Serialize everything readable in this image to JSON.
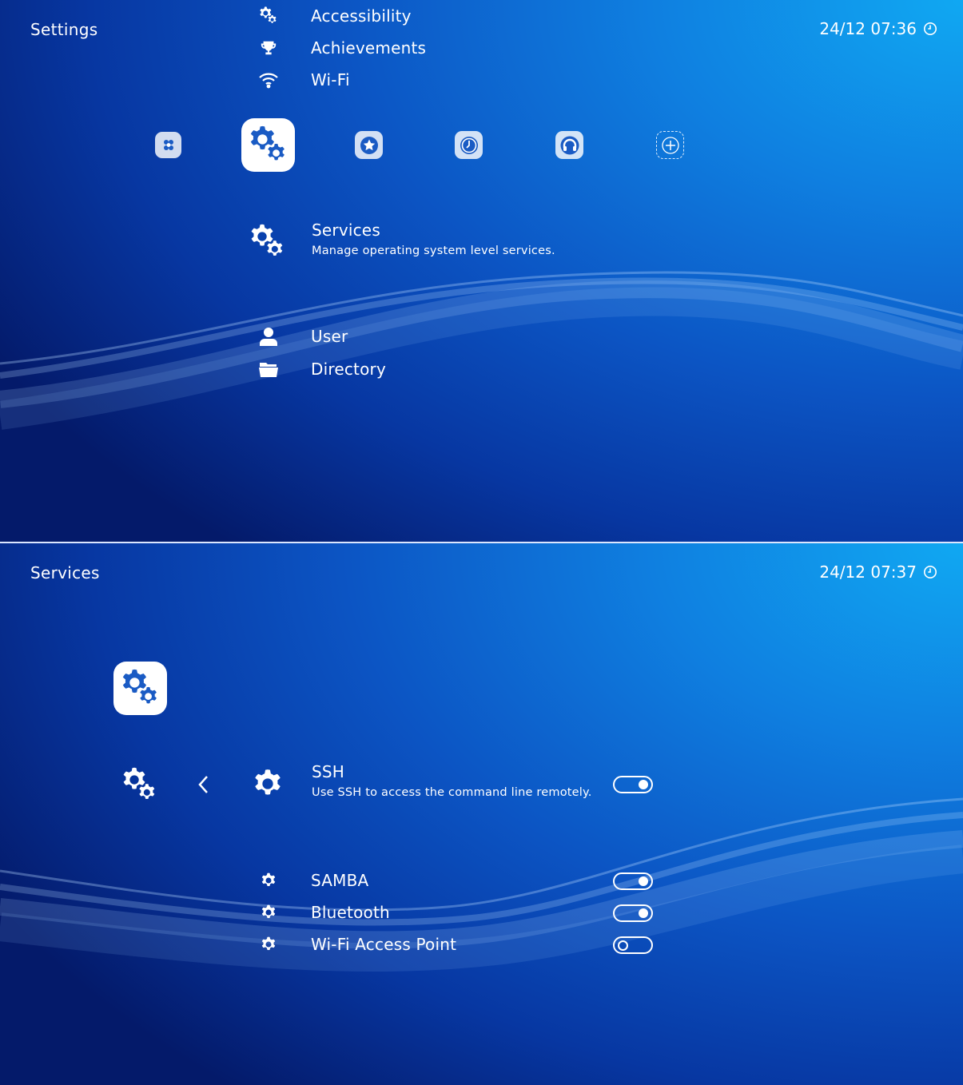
{
  "top": {
    "header": {
      "title": "Settings",
      "clock": "24/12 07:36"
    },
    "upper_items": [
      {
        "label": "Accessibility",
        "icon": "settings-gears-icon"
      },
      {
        "label": "Achievements",
        "icon": "trophy-icon"
      },
      {
        "label": "Wi-Fi",
        "icon": "wifi-icon"
      }
    ],
    "tabs": [
      {
        "icon": "main-menu-icon"
      },
      {
        "icon": "settings-gears-icon",
        "selected": true
      },
      {
        "icon": "favorites-star-icon"
      },
      {
        "icon": "history-clock-icon"
      },
      {
        "icon": "netplay-headset-icon"
      },
      {
        "icon": "add-plus-icon"
      }
    ],
    "selected_item": {
      "label": "Services",
      "description": "Manage operating system level services.",
      "icon": "settings-gears-icon"
    },
    "lower_items": [
      {
        "label": "User",
        "icon": "user-icon"
      },
      {
        "label": "Directory",
        "icon": "folder-icon"
      }
    ]
  },
  "bottom": {
    "header": {
      "title": "Services",
      "clock": "24/12 07:37"
    },
    "selected_item": {
      "label": "SSH",
      "description": "Use SSH to access the command line remotely.",
      "icon": "gear-icon",
      "enabled": true
    },
    "items": [
      {
        "label": "SAMBA",
        "icon": "gear-icon",
        "enabled": true
      },
      {
        "label": "Bluetooth",
        "icon": "gear-icon",
        "enabled": true
      },
      {
        "label": "Wi-Fi Access Point",
        "icon": "gear-icon",
        "enabled": false
      }
    ]
  },
  "colors": {
    "background_light": "#10a8f2",
    "background_dark": "#041a6a",
    "accent": "#1a5bc4",
    "text": "#ffffff"
  }
}
